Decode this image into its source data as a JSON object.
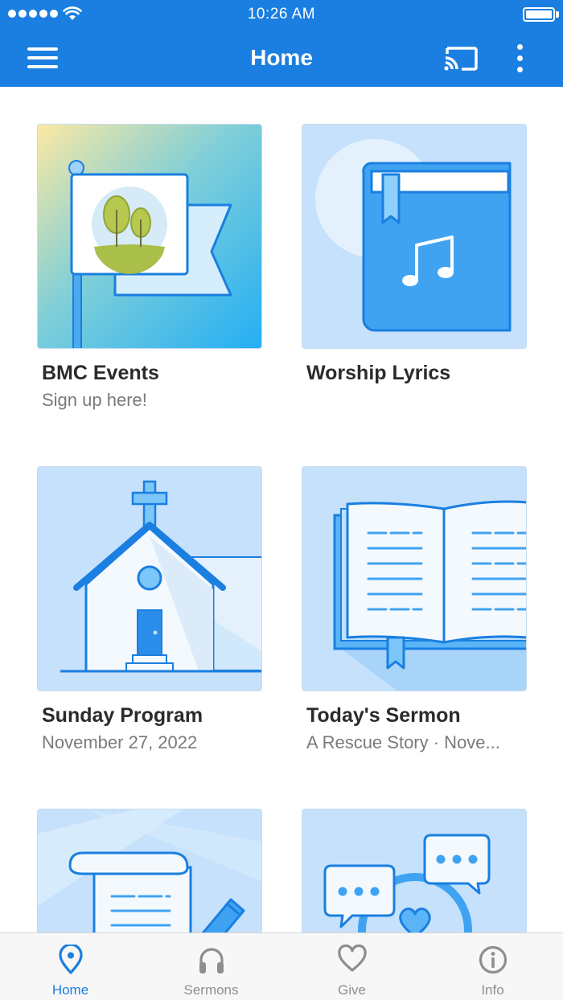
{
  "status_bar": {
    "time": "10:26 AM"
  },
  "app_bar": {
    "title": "Home"
  },
  "cards": [
    {
      "title": "BMC Events",
      "subtitle": "Sign up here!"
    },
    {
      "title": "Worship Lyrics",
      "subtitle": ""
    },
    {
      "title": "Sunday Program",
      "subtitle": "November 27, 2022"
    },
    {
      "title": "Today's Sermon",
      "subtitle": "A Rescue Story · Nove..."
    },
    {
      "title": "",
      "subtitle": ""
    },
    {
      "title": "",
      "subtitle": ""
    }
  ],
  "tabs": [
    {
      "label": "Home",
      "icon": "location-pin-icon",
      "active": true
    },
    {
      "label": "Sermons",
      "icon": "headphones-icon",
      "active": false
    },
    {
      "label": "Give",
      "icon": "heart-icon",
      "active": false
    },
    {
      "label": "Info",
      "icon": "info-icon",
      "active": false
    }
  ],
  "colors": {
    "primary": "#1a7fe0",
    "tile_bg": "#c5e1fb",
    "tab_inactive": "#8e8e8e"
  }
}
